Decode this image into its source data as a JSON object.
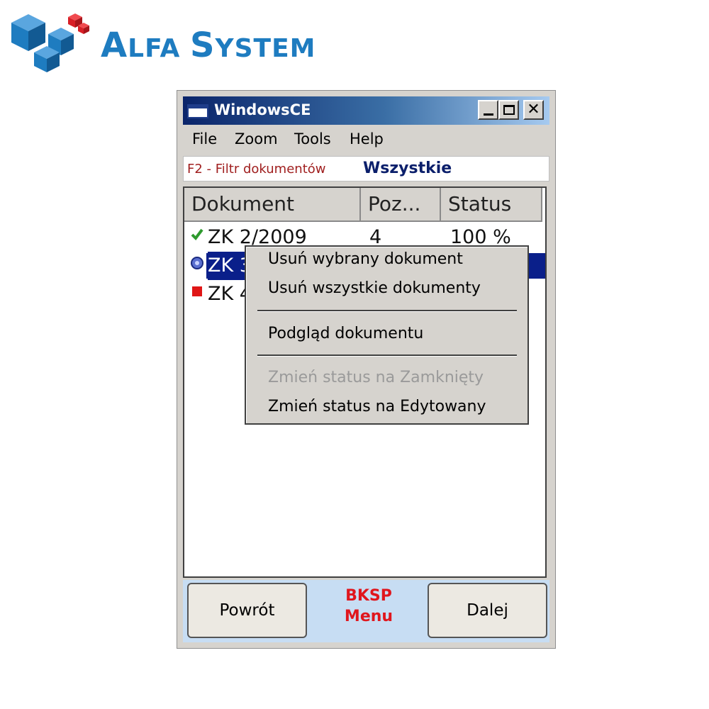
{
  "logo": {
    "text_first_letter": "A",
    "text_rest": "LFA ",
    "text_second_letter": "S",
    "text_second_rest": "YSTEM",
    "colors": {
      "blue": "#1e7cc0",
      "red": "#d81f26"
    }
  },
  "window": {
    "title": "WindowsCE",
    "menu": [
      "File",
      "Zoom",
      "Tools",
      "Help"
    ],
    "filter": {
      "label": "F2 - Filtr dokumentów",
      "value": "Wszystkie"
    },
    "list": {
      "columns": [
        "Dokument",
        "Poz...",
        "Status"
      ],
      "rows": [
        {
          "status_icon": "checkmark-icon",
          "document": "ZK 2/2009",
          "positions": "4",
          "status": "100 %"
        },
        {
          "status_icon": "in-progress-icon",
          "document": "ZK 3",
          "positions": "",
          "status": "",
          "selected": true
        },
        {
          "status_icon": "red-square-icon",
          "document": "ZK 4",
          "positions": "",
          "status": ""
        }
      ]
    },
    "context_menu": {
      "items": [
        {
          "label": "Usuń wybrany dokument",
          "enabled": true
        },
        {
          "label": "Usuń wszystkie dokumenty",
          "enabled": true
        },
        {
          "label": "Podgląd dokumentu",
          "enabled": true
        },
        {
          "label": "Zmień status na Zamknięty",
          "enabled": false
        },
        {
          "label": "Zmień status na Edytowany",
          "enabled": true
        }
      ]
    },
    "bottom": {
      "back_label": "Powrót",
      "hint_line1": "BKSP",
      "hint_line2": "Menu",
      "next_label": "Dalej"
    }
  },
  "colors": {
    "selection": "#0a1f8a",
    "hint": "#e0161d",
    "filter_label": "#a01f1f",
    "filter_value": "#0b1f6b",
    "titlebar_start": "#0a246a",
    "titlebar_end": "#a6caf0"
  }
}
